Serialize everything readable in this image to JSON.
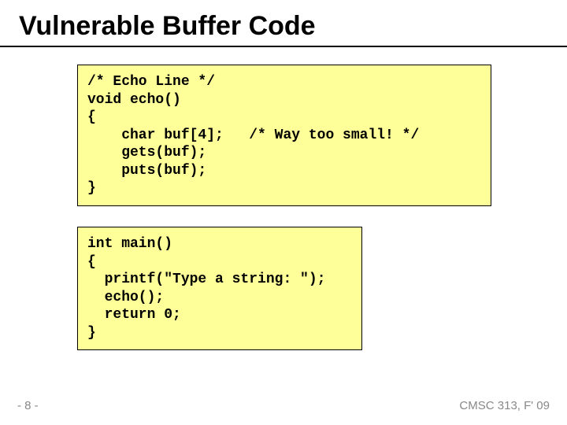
{
  "title": "Vulnerable Buffer Code",
  "code1": "/* Echo Line */\nvoid echo()\n{\n    char buf[4];   /* Way too small! */\n    gets(buf);\n    puts(buf);\n}",
  "code2": "int main()\n{\n  printf(\"Type a string: \");\n  echo();\n  return 0;\n}",
  "footer_left": "- 8 -",
  "footer_right": "CMSC 313, F' 09"
}
